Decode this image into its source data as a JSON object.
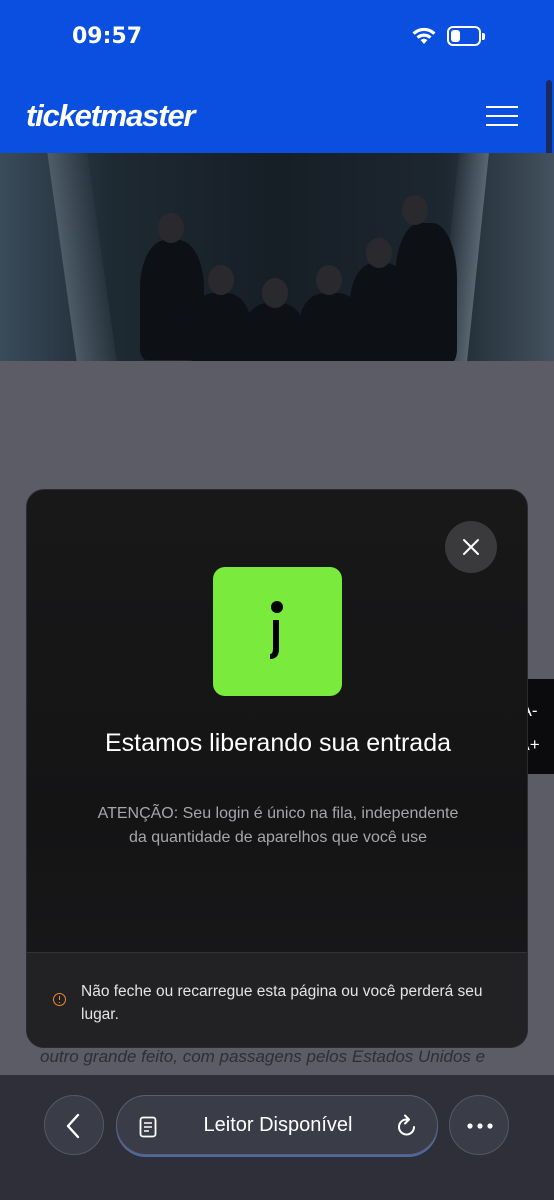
{
  "status": {
    "time": "09:57"
  },
  "header": {
    "logo": "ticketmaster"
  },
  "article": {
    "visible_line": "outro grande feito, com passagens pelos Estados Unidos e"
  },
  "font_controls": {
    "decrease": "A-",
    "increase": "A+"
  },
  "modal": {
    "title": "Estamos liberando sua entrada",
    "warning": "ATENÇÃO: Seu login é único na fila, independente da quantidade de aparelhos que você use",
    "footer_note": "Não feche ou recarregue esta página ou você perderá seu lugar.",
    "accent_color": "#7aea3d",
    "warn_color": "#f08a24"
  },
  "browser": {
    "address_label": "Leitor Disponível"
  },
  "colors": {
    "brand": "#0a4fe0"
  }
}
